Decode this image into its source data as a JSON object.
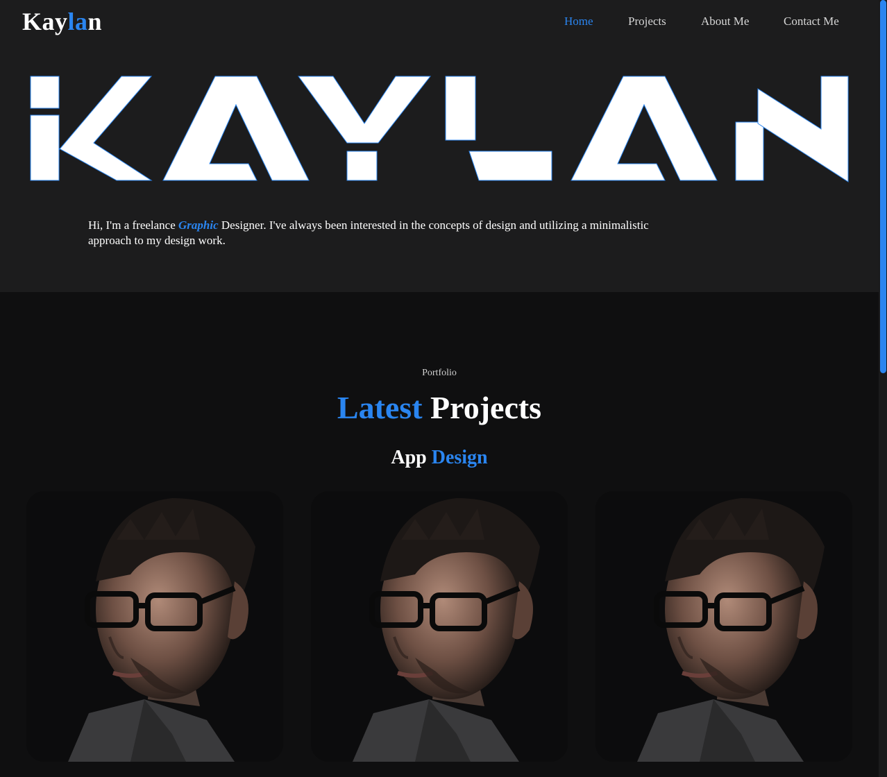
{
  "header": {
    "logo_prefix": "Kay",
    "logo_accent": "la",
    "logo_suffix": "n",
    "nav": [
      {
        "label": "Home",
        "active": true
      },
      {
        "label": "Projects",
        "active": false
      },
      {
        "label": "About Me",
        "active": false
      },
      {
        "label": "Contact Me",
        "active": false
      }
    ]
  },
  "hero": {
    "big_name": "KAYLAN",
    "intro_before": "Hi, I'm a freelance ",
    "intro_highlight": "Graphic",
    "intro_after": " Designer. I've always been interested in the concepts of design and utilizing a minimalistic approach to my design work."
  },
  "portfolio": {
    "eyebrow": "Portfolio",
    "title_accent": "Latest",
    "title_rest": "Projects",
    "subtitle_plain": "App",
    "subtitle_accent": "Design",
    "cards": [
      {
        "image": "portrait-photo"
      },
      {
        "image": "portrait-photo"
      },
      {
        "image": "portrait-photo"
      }
    ]
  },
  "colors": {
    "accent": "#2a85f0",
    "hero_bg": "#1c1c1d",
    "page_bg": "#0f0f10"
  }
}
